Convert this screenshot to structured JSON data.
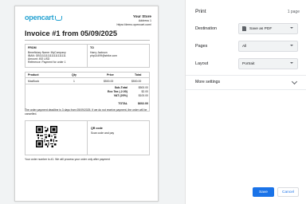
{
  "invoice": {
    "logo": "opencart",
    "store_name": "Your Store",
    "store_address": "Address 1",
    "store_url": "https://demo.opencart.com/",
    "title": "Invoice #1 from 05/09/2025",
    "from_label": "FROM",
    "from_lines": [
      "Beneficiary Name: MyCompany",
      "IBAN: GB11111111111111111111",
      "Amount: 492 USD",
      "Reference: Payment for order 1"
    ],
    "to_label": "TO",
    "to_lines": [
      "Harry Jackson",
      "php14499@strike.com"
    ],
    "table_headers": [
      "Product",
      "Qty",
      "Price",
      "Total"
    ],
    "rows": [
      {
        "product": "MacBook",
        "qty": "1",
        "price": "$500.00",
        "total": "$500.00"
      }
    ],
    "totals": [
      {
        "label": "Sub-Total",
        "value": "$500.00"
      },
      {
        "label": "Eco Tax (-2.00)",
        "value": "$2.00"
      },
      {
        "label": "VAT (20%)",
        "value": "$100.00"
      }
    ],
    "grand_label": "TOTAL",
    "grand_value": "$602.00",
    "deadline_note": "The order payment deadline is 3 days from 05/09/2025. If we do not receive payment, the order will be cancelled.",
    "qr_title": "QR code",
    "qr_text": "Scan code and pay",
    "footer_note": "Your order number is #1. We will process your order only after payment"
  },
  "print_panel": {
    "title": "Print",
    "page_count": "1 page",
    "destination_label": "Destination",
    "destination_value": "Save as PDF",
    "pages_label": "Pages",
    "pages_value": "All",
    "layout_label": "Layout",
    "layout_value": "Portrait",
    "more_settings": "More settings",
    "save": "Save",
    "cancel": "Cancel"
  },
  "colors": {
    "accent": "#1a73e8",
    "brand": "#23a1d1"
  }
}
